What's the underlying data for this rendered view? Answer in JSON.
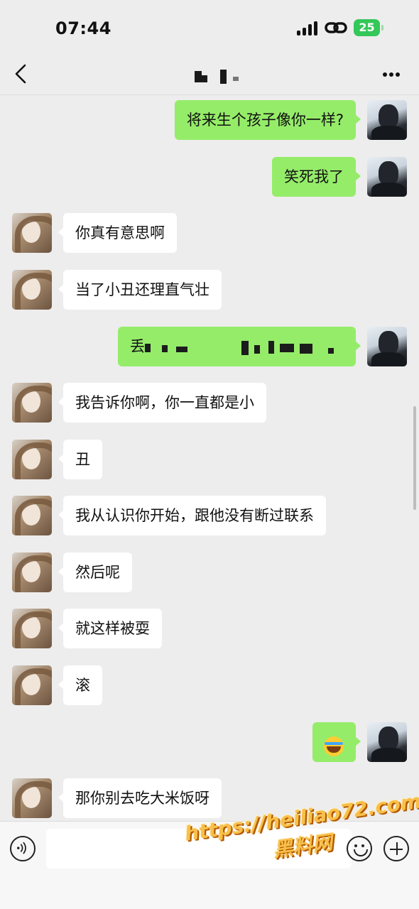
{
  "status_bar": {
    "time": "07:44",
    "battery": "25"
  },
  "chat": {
    "messages": [
      {
        "side": "out",
        "text": "将来生个孩子像你一样?"
      },
      {
        "side": "out",
        "text": "笑死我了"
      },
      {
        "side": "in",
        "text": "你真有意思啊"
      },
      {
        "side": "in",
        "text": "当了小丑还理直气壮"
      },
      {
        "side": "out",
        "text": "丢"
      },
      {
        "side": "in",
        "text": "我告诉你啊，你一直都是小"
      },
      {
        "side": "in",
        "text": "丑"
      },
      {
        "side": "in",
        "text": "我从认识你开始，跟他没有断过联系"
      },
      {
        "side": "in",
        "text": "然后呢"
      },
      {
        "side": "in",
        "text": "就这样被耍"
      },
      {
        "side": "in",
        "text": "滚"
      },
      {
        "side": "out",
        "emoji": "rolling-on-floor-laughing-emoji"
      },
      {
        "side": "in",
        "text": "那你别去吃大米饭呀"
      }
    ]
  },
  "watermark": {
    "url": "https://heiliao72.com",
    "name": "黑料网"
  },
  "icons": {
    "back": "chevron-left-icon",
    "more": "more-dots-icon",
    "voice": "voice-icon",
    "emoji": "smiley-icon",
    "plus": "plus-icon"
  },
  "colors": {
    "outgoing_bubble": "#95ec69",
    "incoming_bubble": "#ffffff",
    "background": "#ededed",
    "battery": "#34c759"
  }
}
